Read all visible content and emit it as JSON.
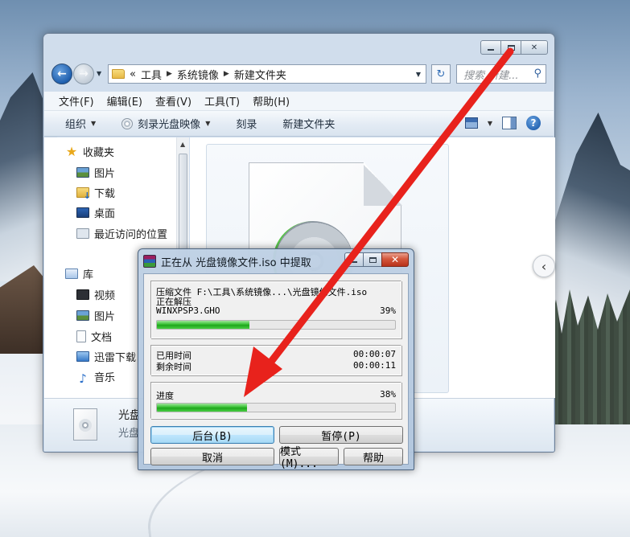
{
  "explorer": {
    "breadcrumb": {
      "overflow": "«",
      "parts": [
        "工具",
        "系统镜像",
        "新建文件夹"
      ]
    },
    "search_placeholder": "搜索 新建...",
    "menu": [
      "文件(F)",
      "编辑(E)",
      "查看(V)",
      "工具(T)",
      "帮助(H)"
    ],
    "toolbar": {
      "organize": "组织",
      "burn_image": "刻录光盘映像",
      "burn": "刻录",
      "new_folder": "新建文件夹"
    },
    "nav": {
      "favorites": {
        "label": "收藏夹",
        "items": [
          "图片",
          "下载",
          "桌面",
          "最近访问的位置"
        ]
      },
      "libraries": {
        "label": "库",
        "items": [
          "视频",
          "图片",
          "文档",
          "迅雷下载",
          "音乐"
        ]
      }
    },
    "details": {
      "name": "光盘",
      "type": "光盘"
    }
  },
  "dialog": {
    "title": "正在从 光盘镜像文件.iso 中提取",
    "archive_line": "压缩文件 F:\\工具\\系统镜像...\\光盘镜像文件.iso",
    "status": "正在解压",
    "current_file": "WINXPSP3.GHO",
    "file_percent_label": "39%",
    "file_progress": 0.39,
    "elapsed_label": "已用时间",
    "elapsed_value": "00:00:07",
    "remaining_label": "剩余时间",
    "remaining_value": "00:00:11",
    "overall_label": "进度",
    "overall_percent_label": "38%",
    "overall_progress": 0.38,
    "buttons": {
      "background": "后台(B)",
      "pause": "暂停(P)",
      "cancel": "取消",
      "mode": "模式(M)...",
      "help": "帮助"
    }
  },
  "colors": {
    "arrow": "#e8221c",
    "progress": "#28b524",
    "close_button": "#c7432a"
  }
}
